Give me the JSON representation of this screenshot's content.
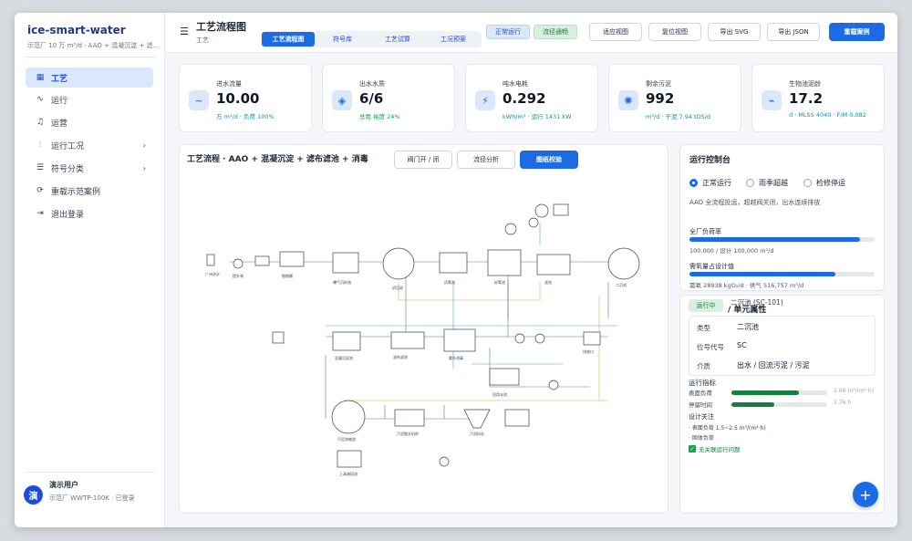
{
  "brand": "ice-smart-water",
  "brand_sub": "示范厂 10 万 m³/d · AAO + 混凝沉淀 + 滤...",
  "nav": [
    {
      "icon": "grid-icon",
      "glyph": "▦",
      "label": "工艺",
      "active": true
    },
    {
      "icon": "activity-icon",
      "glyph": "∿",
      "label": "运行"
    },
    {
      "icon": "bell-icon",
      "glyph": "♫",
      "label": "运营"
    },
    {
      "icon": "sliders-icon",
      "glyph": "⫶",
      "label": "运行工况",
      "chev": "›"
    },
    {
      "icon": "layers-icon",
      "glyph": "☰",
      "label": "符号分类",
      "chev": "›"
    },
    {
      "icon": "reload-icon",
      "glyph": "⟳",
      "label": "重载示范案例"
    },
    {
      "icon": "logout-icon",
      "glyph": "⇥",
      "label": "退出登录"
    }
  ],
  "user": {
    "avatar": "演",
    "name": "演示用户",
    "sub": "示范厂 WWTP-100K · 已登录"
  },
  "header": {
    "title": "工艺流程图",
    "crumb": "工艺",
    "tabs": [
      "工艺流程图",
      "符号库",
      "工艺试算",
      "工况预案"
    ],
    "status1": "正常运行",
    "status2": "流径通畅",
    "buttons": [
      "适应视图",
      "复位视图",
      "导出 SVG",
      "导出 JSON"
    ],
    "primary": "重载案例"
  },
  "kpis": [
    {
      "icon": "wave-icon",
      "glyph": "~",
      "label": "进水流量",
      "value": "10.00",
      "sub": "万 m³/d · 负荷 100%"
    },
    {
      "icon": "diamond-icon",
      "glyph": "◈",
      "label": "出水水质",
      "value": "6/6",
      "sub": "总氮 裕度 24%",
      "green": true
    },
    {
      "icon": "bolt-icon",
      "glyph": "⚡",
      "label": "吨水电耗",
      "value": "0.292",
      "sub": "kWh/m³ · 运行 1431 kW"
    },
    {
      "icon": "gear-icon",
      "glyph": "✺",
      "label": "剩余污泥",
      "value": "992",
      "sub": "m³/d · 干泥 7.94 tDS/d"
    },
    {
      "icon": "bio-icon",
      "glyph": "⌁",
      "label": "生物池泥龄",
      "value": "17.2",
      "sub": "d · MLSS 4040 · F/M 0.082"
    }
  ],
  "canvas": {
    "title": "工艺流程 · AAO + 混凝沉淀 + 滤布滤池 + 消毒",
    "buttons": [
      "阀门开 / 闭",
      "流径分析",
      "图纸校验"
    ]
  },
  "control": {
    "title": "运行控制台",
    "modes": [
      "正常运行",
      "雨季超越",
      "检修停运"
    ],
    "desc": "AAO 全流程投运，超越阀关闭，出水连续排放",
    "load_label": "全厂负荷率",
    "load_value": "100,000 / 设计 100,000 m³/d",
    "load_frac": 0.92,
    "oxy_label": "需氧量占设计值",
    "oxy_value": "需氧 28938 kgO₂/d · 供气 516,757 m³/d",
    "oxy_frac": 0.79
  },
  "detail": {
    "badge": "运行中",
    "title": "/ 单元属性",
    "title_overlap": "二沉池 (SC-101)",
    "rows": [
      [
        "类型",
        "二沉池"
      ],
      [
        "位号代号",
        "SC"
      ],
      [
        "介质",
        "出水 / 回流污泥 / 污泥"
      ]
    ],
    "metrics_title": "运行指标",
    "metrics": [
      {
        "label": "表面负荷",
        "value": "1.08 m³/(m²·h)",
        "frac": 0.7
      },
      {
        "label": "停留时间",
        "value": "1.76 h",
        "frac": 0.45
      }
    ],
    "focus_title": "设计关注",
    "focus": [
      "· 表面负荷 1.5~2.5 m³/(m²·h)",
      "· 固体负荷"
    ],
    "check": "无关联运行问题"
  },
  "fab": "+",
  "colors": {
    "accent": "#1d6ae5",
    "green": "#16a34a",
    "cyan": "#0891b2"
  }
}
